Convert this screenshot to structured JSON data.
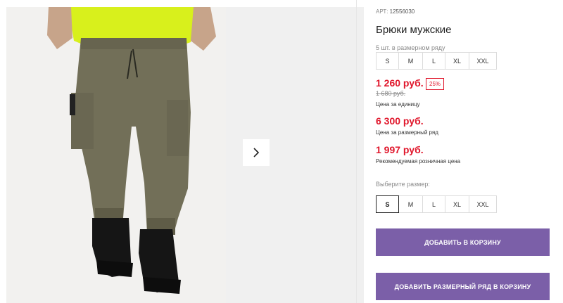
{
  "gallery": {
    "next_icon": "chevron-right-icon"
  },
  "product": {
    "sku_label": "АРТ:",
    "sku_value": "12556030",
    "title": "Брюки мужские",
    "pack_note": "5 шт. в размерном ряду",
    "pack_sizes": [
      "S",
      "M",
      "L",
      "XL",
      "XXL"
    ],
    "price_unit": "1 260 руб.",
    "discount": "25%",
    "old_price": "1 680 руб.",
    "price_unit_note": "Цена за единицу",
    "price_pack": "6 300 руб.",
    "price_pack_note": "Цена за размерный ряд",
    "price_retail": "1 997 руб.",
    "price_retail_note": "Рекомендуемая розничная цена",
    "size_select_label": "Выберите размер:",
    "select_sizes": [
      "S",
      "M",
      "L",
      "XL",
      "XXL"
    ],
    "selected_size": "S"
  },
  "actions": {
    "add_to_cart": "ДОБАВИТЬ В КОРЗИНУ",
    "add_pack_to_cart": "ДОБАВИТЬ РАЗМЕРНЫЙ РЯД В КОРЗИНУ"
  },
  "colors": {
    "accent": "#7b5fa8",
    "price_red": "#e0162b"
  }
}
